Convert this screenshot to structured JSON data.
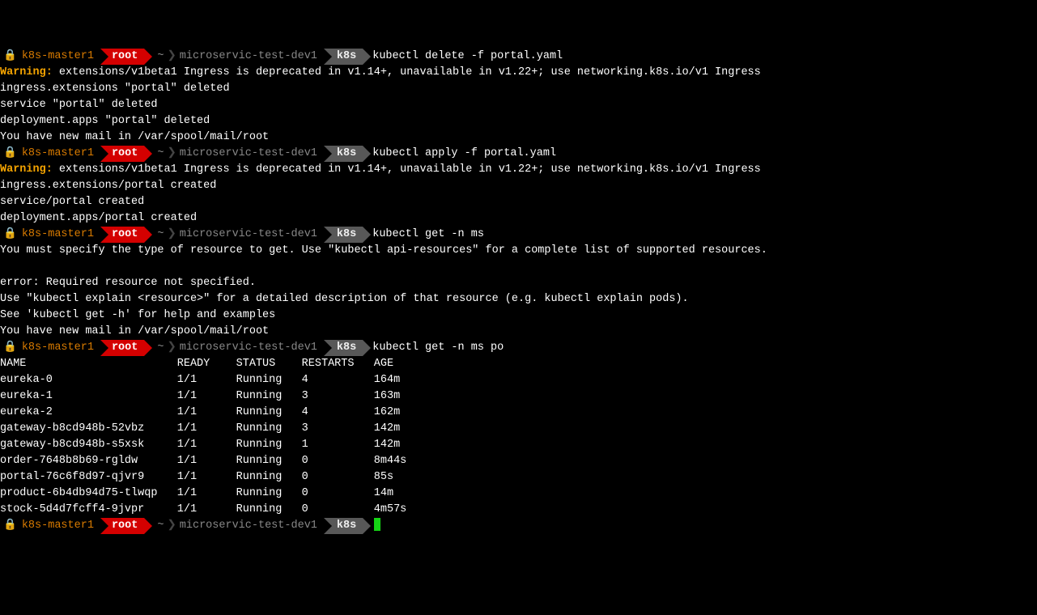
{
  "prompt": {
    "host": "k8s-master1",
    "user": "root",
    "home": "~",
    "path": "microservic-test-dev1",
    "subdir": "k8s",
    "lock_icon": "🔒"
  },
  "cmd1": "kubectl delete -f portal.yaml",
  "out1": {
    "warning_label": "Warning:",
    "warning_text": " extensions/v1beta1 Ingress is deprecated in v1.14+, unavailable in v1.22+; use networking.k8s.io/v1 Ingress",
    "l1": "ingress.extensions \"portal\" deleted",
    "l2": "service \"portal\" deleted",
    "l3": "deployment.apps \"portal\" deleted",
    "l4": "You have new mail in /var/spool/mail/root"
  },
  "cmd2": "kubectl apply -f portal.yaml",
  "out2": {
    "warning_label": "Warning:",
    "warning_text": " extensions/v1beta1 Ingress is deprecated in v1.14+, unavailable in v1.22+; use networking.k8s.io/v1 Ingress",
    "l1": "ingress.extensions/portal created",
    "l2": "service/portal created",
    "l3": "deployment.apps/portal created"
  },
  "cmd3": "kubectl get -n ms",
  "out3": {
    "l1": "You must specify the type of resource to get. Use \"kubectl api-resources\" for a complete list of supported resources.",
    "blank": "",
    "l2": "error: Required resource not specified.",
    "l3": "Use \"kubectl explain <resource>\" for a detailed description of that resource (e.g. kubectl explain pods).",
    "l4": "See 'kubectl get -h' for help and examples",
    "l5": "You have new mail in /var/spool/mail/root"
  },
  "cmd4": "kubectl get -n ms po",
  "table": {
    "header": {
      "name": "NAME",
      "ready": "READY",
      "status": "STATUS",
      "restarts": "RESTARTS",
      "age": "AGE"
    },
    "rows": [
      {
        "name": "eureka-0",
        "ready": "1/1",
        "status": "Running",
        "restarts": "4",
        "age": "164m"
      },
      {
        "name": "eureka-1",
        "ready": "1/1",
        "status": "Running",
        "restarts": "3",
        "age": "163m"
      },
      {
        "name": "eureka-2",
        "ready": "1/1",
        "status": "Running",
        "restarts": "4",
        "age": "162m"
      },
      {
        "name": "gateway-b8cd948b-52vbz",
        "ready": "1/1",
        "status": "Running",
        "restarts": "3",
        "age": "142m"
      },
      {
        "name": "gateway-b8cd948b-s5xsk",
        "ready": "1/1",
        "status": "Running",
        "restarts": "1",
        "age": "142m"
      },
      {
        "name": "order-7648b8b69-rgldw",
        "ready": "1/1",
        "status": "Running",
        "restarts": "0",
        "age": "8m44s"
      },
      {
        "name": "portal-76c6f8d97-qjvr9",
        "ready": "1/1",
        "status": "Running",
        "restarts": "0",
        "age": "85s"
      },
      {
        "name": "product-6b4db94d75-tlwqp",
        "ready": "1/1",
        "status": "Running",
        "restarts": "0",
        "age": "14m"
      },
      {
        "name": "stock-5d4d7fcff4-9jvpr",
        "ready": "1/1",
        "status": "Running",
        "restarts": "0",
        "age": "4m57s"
      }
    ]
  },
  "cmd5": ""
}
